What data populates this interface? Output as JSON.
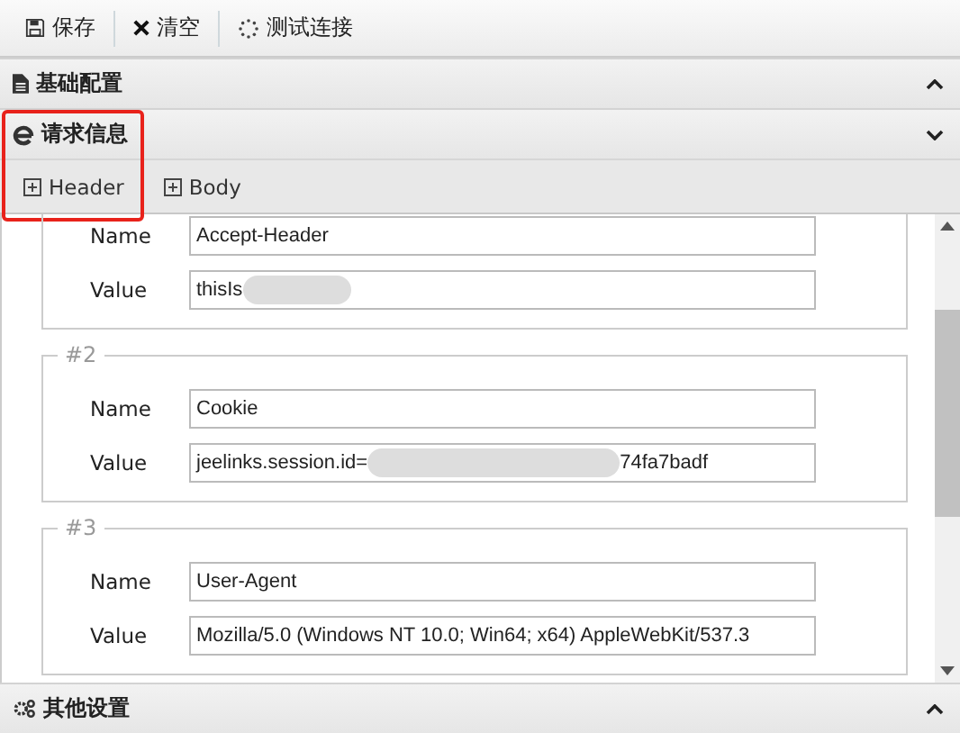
{
  "toolbar": [
    {
      "label": "保存"
    },
    {
      "label": "清空"
    },
    {
      "label": "测试连接"
    }
  ],
  "sections": [
    {
      "title": "基础配置",
      "expanded": false
    },
    {
      "title": "请求信息",
      "expanded": true,
      "tabs": [
        {
          "label": "Header"
        },
        {
          "label": "Body"
        }
      ],
      "groups": [
        {
          "fields": [
            {
              "label": "Name",
              "value": "Accept-Header"
            },
            {
              "label": "Value",
              "value": "thisIs",
              "redacted": true
            }
          ]
        },
        {
          "legend": "#2",
          "fields": [
            {
              "label": "Name",
              "value": "Cookie"
            },
            {
              "label": "Value",
              "value": "jeelinks.session.id=",
              "redacted": true,
              "value_end": "74fa7badf"
            }
          ]
        },
        {
          "legend": "#3",
          "fields": [
            {
              "label": "Name",
              "value": "User-Agent"
            },
            {
              "label": "Value",
              "value": "Mozilla/5.0 (Windows NT 10.0; Win64; x64) AppleWebKit/537.3"
            }
          ]
        }
      ]
    },
    {
      "title": "其他设置",
      "expanded": false
    }
  ],
  "highlight": true
}
